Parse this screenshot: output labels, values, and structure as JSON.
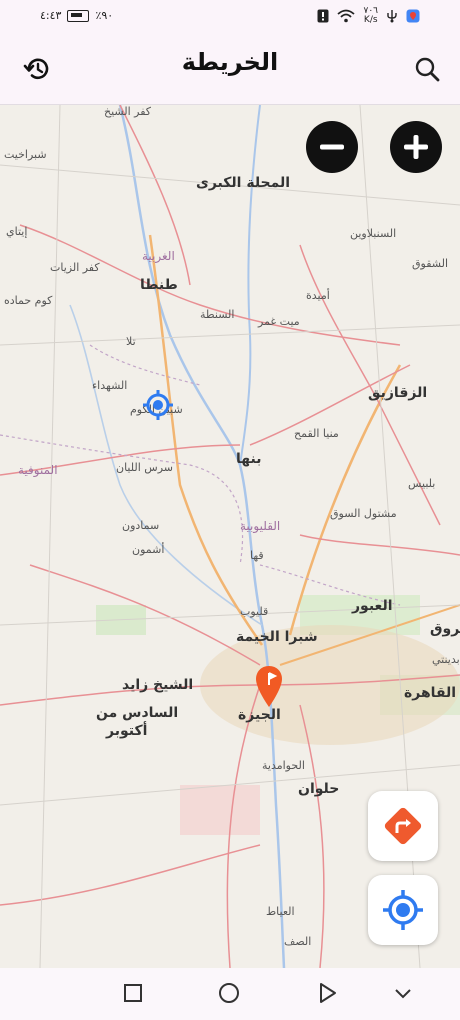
{
  "status_bar": {
    "battery": "٪٩٠",
    "time": "٤:٤٣",
    "net_speed_value": "٧٠٦",
    "net_speed_unit": "K/s"
  },
  "header": {
    "title": "الخريطة",
    "history_icon": "history-icon",
    "search_icon": "search-icon"
  },
  "map": {
    "labels": [
      {
        "text": "كفر الشيخ",
        "cls": ""
      },
      {
        "text": "شبراخيت",
        "cls": ""
      },
      {
        "text": "المحلة الكبرى",
        "cls": "big"
      },
      {
        "text": "السنبلاوين",
        "cls": ""
      },
      {
        "text": "الشقوق",
        "cls": ""
      },
      {
        "text": "إيتاي",
        "cls": ""
      },
      {
        "text": "كفر الزيات",
        "cls": ""
      },
      {
        "text": "الغربية",
        "cls": "gov"
      },
      {
        "text": "طنطا",
        "cls": "big"
      },
      {
        "text": "أميدة",
        "cls": ""
      },
      {
        "text": "كوم حماده",
        "cls": ""
      },
      {
        "text": "السنطة",
        "cls": ""
      },
      {
        "text": "ميت غمر",
        "cls": ""
      },
      {
        "text": "تلا",
        "cls": ""
      },
      {
        "text": "الشهداء",
        "cls": ""
      },
      {
        "text": "الزقازيق",
        "cls": "big"
      },
      {
        "text": "شبين الكوم",
        "cls": ""
      },
      {
        "text": "منيا القمح",
        "cls": ""
      },
      {
        "text": "المنوفية",
        "cls": "gov"
      },
      {
        "text": "سرس الليان",
        "cls": ""
      },
      {
        "text": "بنها",
        "cls": "big"
      },
      {
        "text": "بلبيس",
        "cls": ""
      },
      {
        "text": "سمادون",
        "cls": ""
      },
      {
        "text": "القليوبية",
        "cls": "gov"
      },
      {
        "text": "مشتول السوق",
        "cls": ""
      },
      {
        "text": "أشمون",
        "cls": ""
      },
      {
        "text": "قها",
        "cls": ""
      },
      {
        "text": "العبور",
        "cls": "big"
      },
      {
        "text": "قليوب",
        "cls": ""
      },
      {
        "text": "شروق",
        "cls": "big"
      },
      {
        "text": "شبرا الخيمة",
        "cls": "big"
      },
      {
        "text": "الشيخ زايد",
        "cls": "big"
      },
      {
        "text": "بدينتي",
        "cls": ""
      },
      {
        "text": "القاهرة",
        "cls": "big"
      },
      {
        "text": "السادس من",
        "cls": "big"
      },
      {
        "text": "أكتوبر",
        "cls": "big"
      },
      {
        "text": "الجيزة",
        "cls": "big"
      },
      {
        "text": "الحوامدية",
        "cls": ""
      },
      {
        "text": "حلوان",
        "cls": "big"
      },
      {
        "text": "العياط",
        "cls": ""
      },
      {
        "text": "الصف",
        "cls": ""
      }
    ],
    "marker_icon": "location-pin-icon",
    "current_location_icon": "current-location-icon"
  },
  "controls": {
    "zoom_out_icon": "minus-icon",
    "zoom_in_icon": "plus-icon",
    "directions_icon": "directions-icon",
    "my_location_icon": "my-location-icon"
  },
  "nav_bar": {
    "recent_icon": "square-icon",
    "home_icon": "circle-icon",
    "back_icon": "triangle-icon",
    "hide_icon": "chevron-down-icon"
  }
}
